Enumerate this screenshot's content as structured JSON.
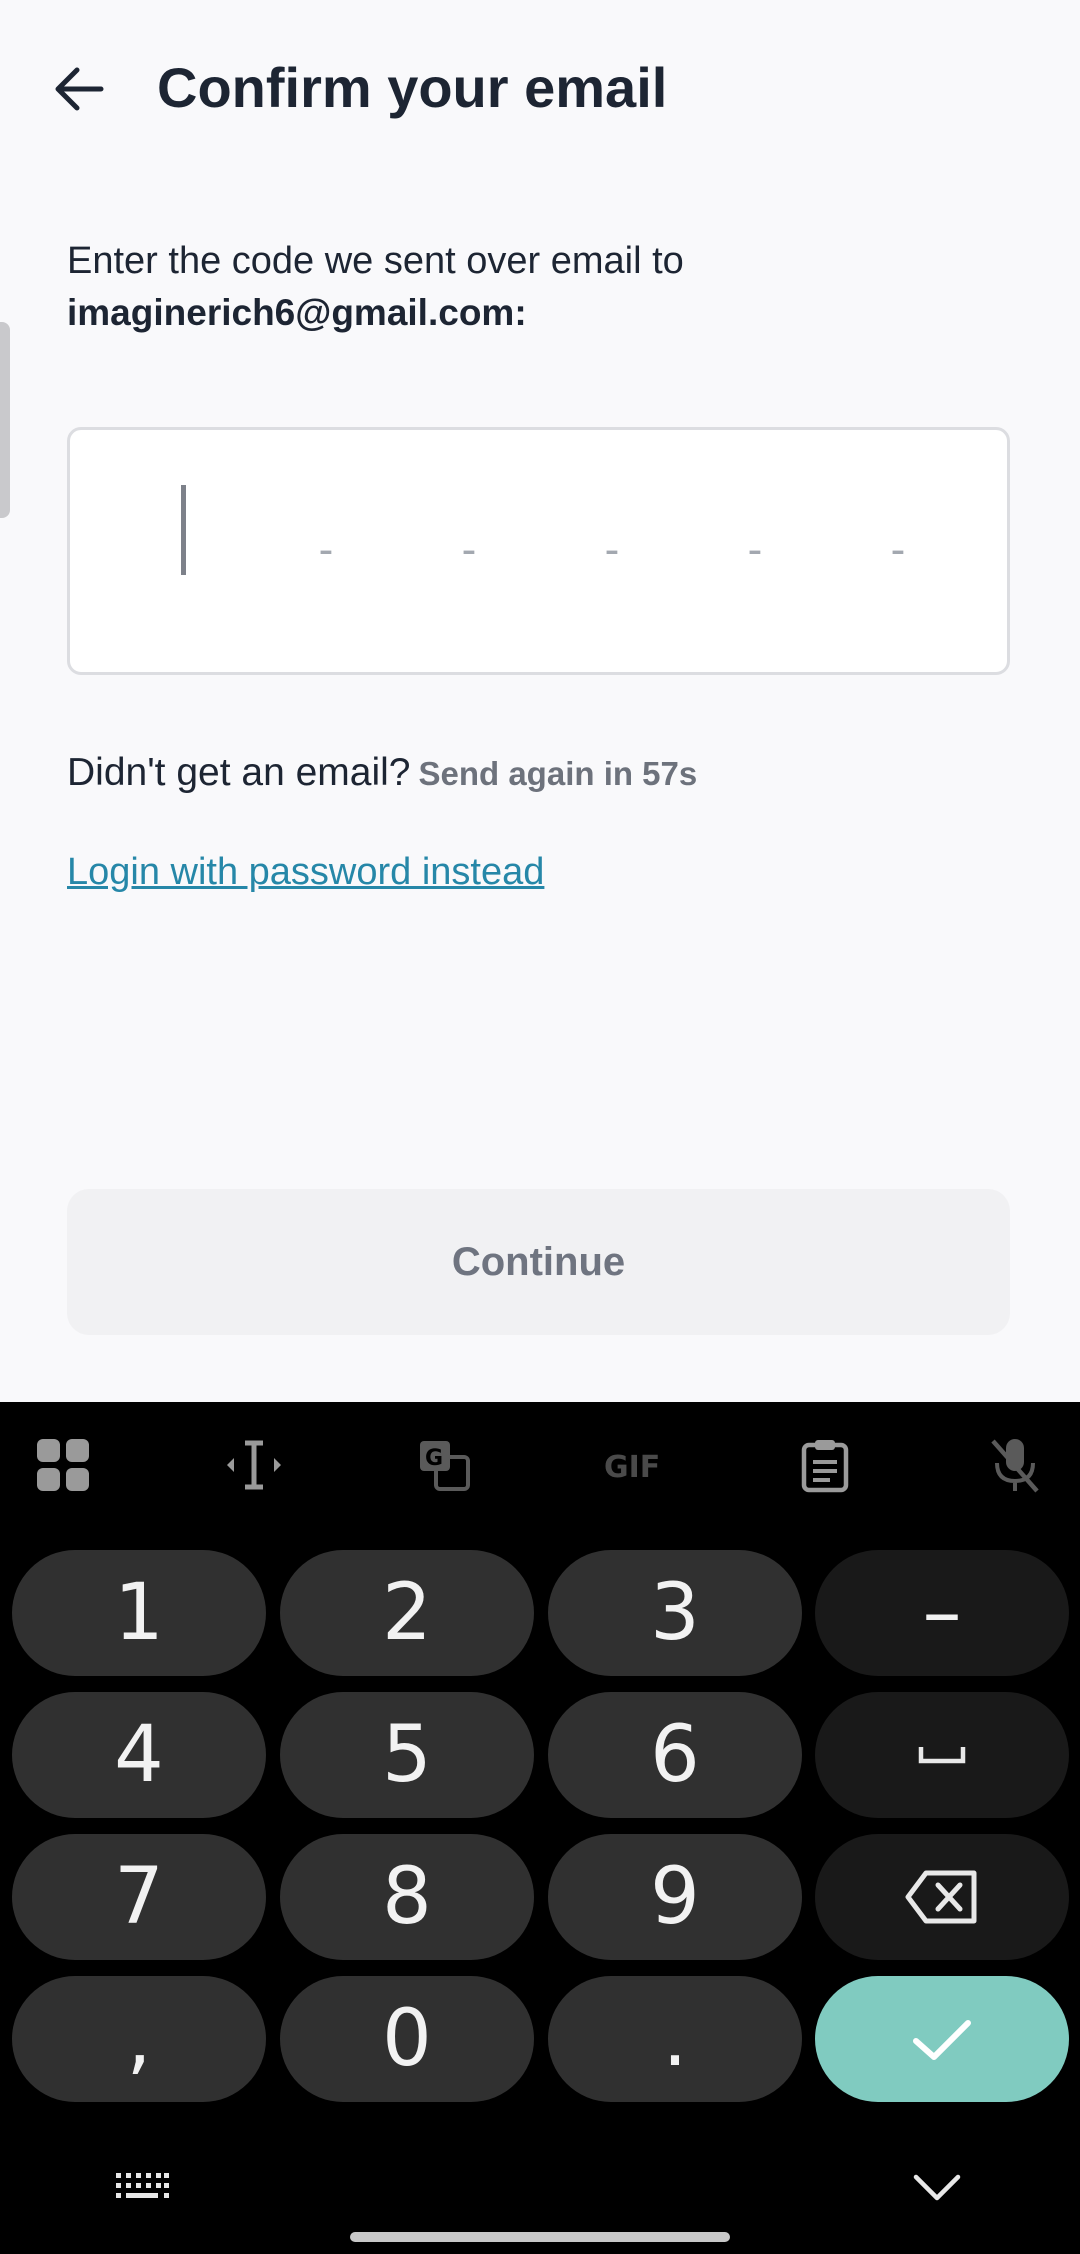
{
  "header": {
    "title": "Confirm your email",
    "back_icon": "arrow-left-icon"
  },
  "instruction": {
    "text": "Enter the code we sent over email to",
    "email": "imaginerich6@gmail.com:"
  },
  "code_input": {
    "slots": [
      "-",
      "-",
      "-",
      "-",
      "-"
    ],
    "value": ""
  },
  "resend": {
    "label": "Didn't get an email?",
    "timer": "Send again in 57s"
  },
  "login_link": {
    "label": "Login with password instead"
  },
  "continue_button": {
    "label": "Continue"
  },
  "keyboard": {
    "toolbar": [
      "apps-grid-icon",
      "text-cursor-icon",
      "translate-icon",
      "gif-icon",
      "clipboard-icon",
      "mic-off-icon"
    ],
    "gif_label": "GIF",
    "keys": {
      "k1": "1",
      "k2": "2",
      "k3": "3",
      "dash": "–",
      "k4": "4",
      "k5": "5",
      "k6": "6",
      "space": "␣",
      "k7": "7",
      "k8": "8",
      "k9": "9",
      "comma": ",",
      "k0": "0",
      "period": "."
    }
  },
  "colors": {
    "link": "#2687a8",
    "enter_key": "#80cbc0",
    "key": "#303030",
    "background": "#f9f9fb"
  }
}
